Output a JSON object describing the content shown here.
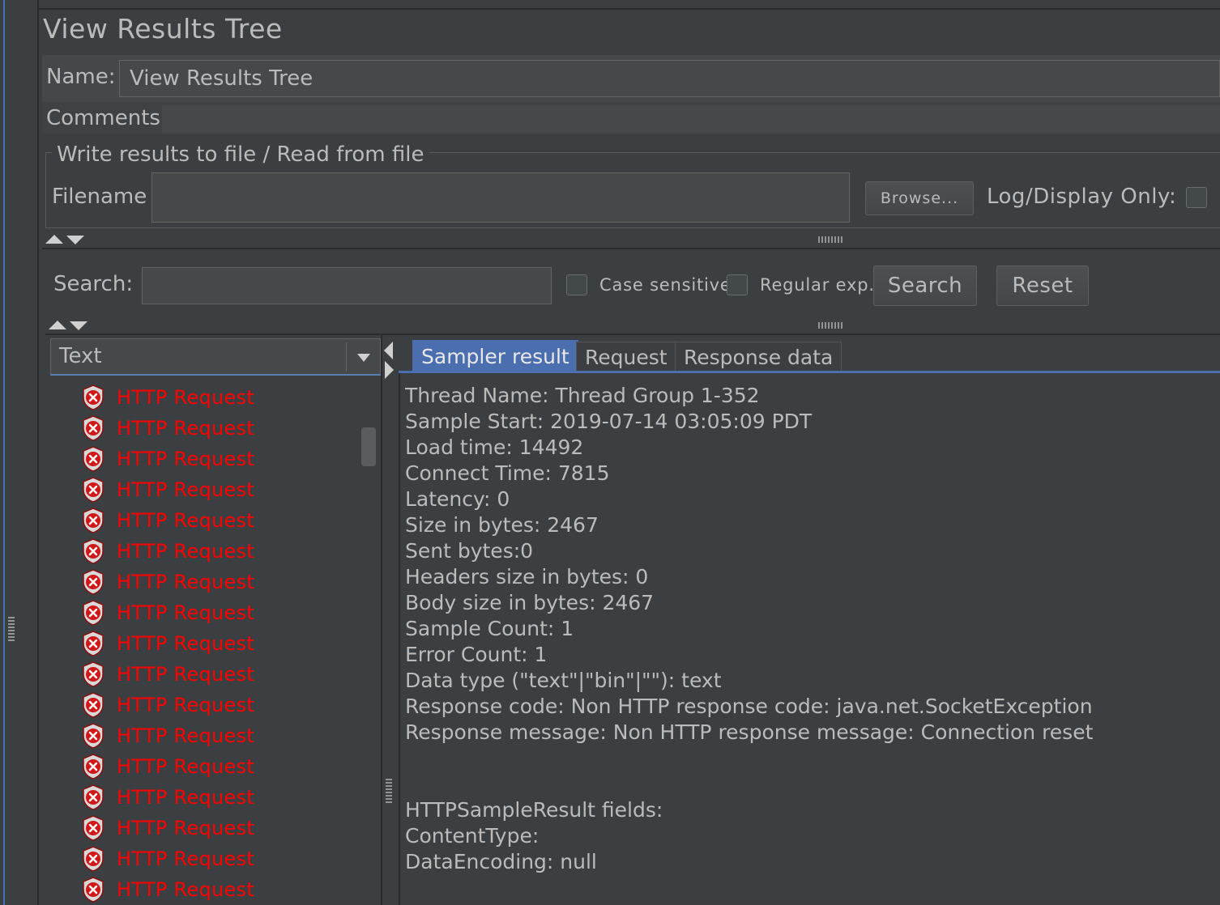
{
  "title": "View Results Tree",
  "name": {
    "label": "Name:",
    "value": "View Results Tree"
  },
  "comments": {
    "label": "Comments:",
    "value": ""
  },
  "file": {
    "legend": "Write results to file / Read from file",
    "filename_label": "Filename",
    "filename_value": "",
    "browse": "Browse...",
    "log_display_only": "Log/Display Only:"
  },
  "search": {
    "label": "Search:",
    "value": "",
    "case_sensitive": "Case sensitive",
    "regular_exp": "Regular exp.",
    "search_btn": "Search",
    "reset_btn": "Reset"
  },
  "renderer": {
    "selected": "Text"
  },
  "tree_items": [
    "HTTP Request",
    "HTTP Request",
    "HTTP Request",
    "HTTP Request",
    "HTTP Request",
    "HTTP Request",
    "HTTP Request",
    "HTTP Request",
    "HTTP Request",
    "HTTP Request",
    "HTTP Request",
    "HTTP Request",
    "HTTP Request",
    "HTTP Request",
    "HTTP Request",
    "HTTP Request",
    "HTTP Request"
  ],
  "tabs": [
    "Sampler result",
    "Request",
    "Response data"
  ],
  "detail_lines": [
    "Thread Name: Thread Group 1-352",
    "Sample Start: 2019-07-14 03:05:09 PDT",
    "Load time: 14492",
    "Connect Time: 7815",
    "Latency: 0",
    "Size in bytes: 2467",
    "Sent bytes:0",
    "Headers size in bytes: 0",
    "Body size in bytes: 2467",
    "Sample Count: 1",
    "Error Count: 1",
    "Data type (\"text\"|\"bin\"|\"\"): text",
    "Response code: Non HTTP response code: java.net.SocketException",
    "Response message: Non HTTP response message: Connection reset",
    "",
    "",
    "HTTPSampleResult fields:",
    "ContentType: ",
    "DataEncoding: null"
  ],
  "colors": {
    "error_text": "#ff0000",
    "active_tab": "#4b6eaf",
    "background": "#3c3f41"
  }
}
